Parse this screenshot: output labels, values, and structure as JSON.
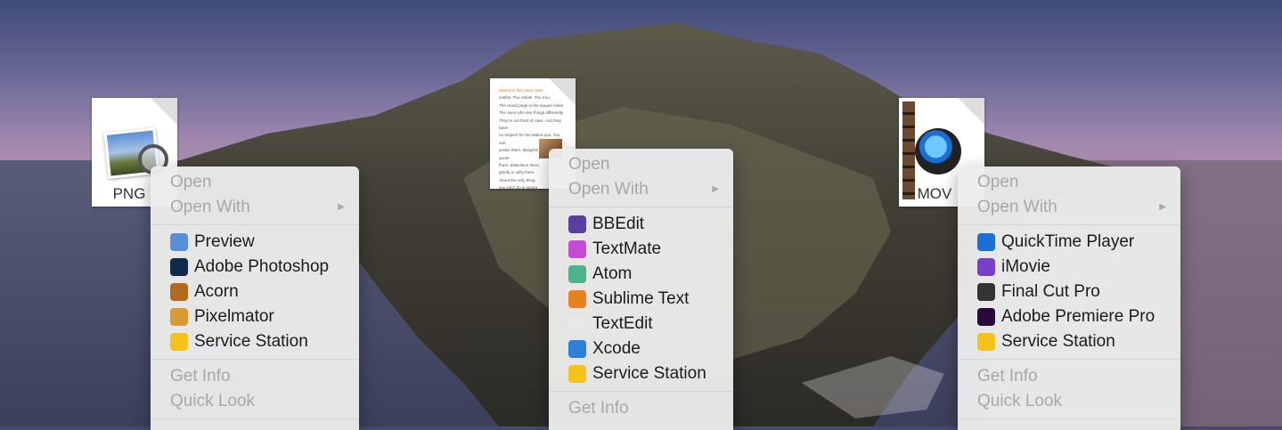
{
  "files": {
    "png": {
      "ext": "PNG"
    },
    "mov": {
      "ext": "MOV"
    },
    "txt": {
      "snippet_lines": [
        "Here's to the crazy ones",
        "misfits. The rebels. The trou",
        "The round pegs in the square holes",
        "The ones who see things differently",
        "They're not fond of rules. And they have",
        "no respect for the status quo. You can",
        "praise them, disagree with them, quote",
        "them, disbelieve them,",
        "glorify or vilify them.",
        "About the only thing",
        "you can't do is ignore",
        "them. Because they",
        "change things."
      ]
    }
  },
  "menu_common": {
    "open": "Open",
    "open_with": "Open With",
    "get_info": "Get Info",
    "quick_look": "Quick Look"
  },
  "png_menu": {
    "apps": [
      {
        "label": "Preview",
        "icon": "preview-icon",
        "color": "#5a8fd8"
      },
      {
        "label": "Adobe Photoshop",
        "icon": "photoshop-icon",
        "color": "#0f2a4a"
      },
      {
        "label": "Acorn",
        "icon": "acorn-icon",
        "color": "#b36a1e"
      },
      {
        "label": "Pixelmator",
        "icon": "pixelmator-icon",
        "color": "#d99a32"
      },
      {
        "label": "Service Station",
        "icon": "service-station-icon",
        "color": "#f5c21b"
      }
    ]
  },
  "txt_menu": {
    "apps": [
      {
        "label": "BBEdit",
        "icon": "bbedit-icon",
        "color": "#5b3fa0"
      },
      {
        "label": "TextMate",
        "icon": "textmate-icon",
        "color": "#c44bd6"
      },
      {
        "label": "Atom",
        "icon": "atom-icon",
        "color": "#4fb389"
      },
      {
        "label": "Sublime Text",
        "icon": "sublime-text-icon",
        "color": "#e6821e"
      },
      {
        "label": "TextEdit",
        "icon": "textedit-icon",
        "color": "#e8e8e8"
      },
      {
        "label": "Xcode",
        "icon": "xcode-icon",
        "color": "#2d7fd8"
      },
      {
        "label": "Service Station",
        "icon": "service-station-icon",
        "color": "#f5c21b"
      }
    ]
  },
  "mov_menu": {
    "apps": [
      {
        "label": "QuickTime Player",
        "icon": "quicktime-icon",
        "color": "#1c6fd3"
      },
      {
        "label": "iMovie",
        "icon": "imovie-icon",
        "color": "#7a3fc9"
      },
      {
        "label": "Final Cut Pro",
        "icon": "final-cut-pro-icon",
        "color": "#333333"
      },
      {
        "label": "Adobe Premiere Pro",
        "icon": "premiere-pro-icon",
        "color": "#2a0a3d"
      },
      {
        "label": "Service Station",
        "icon": "service-station-icon",
        "color": "#f5c21b"
      }
    ]
  }
}
